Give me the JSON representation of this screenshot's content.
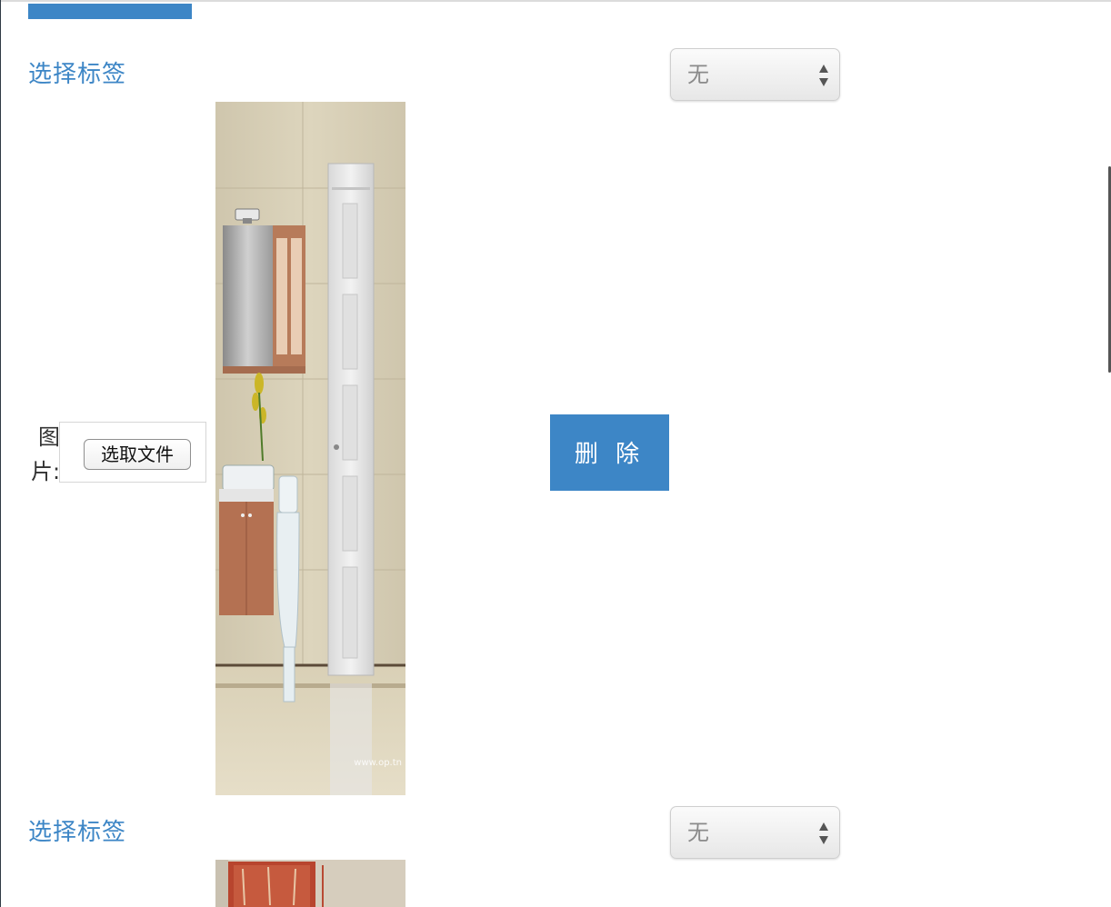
{
  "entries": [
    {
      "tag_label": "选择标签",
      "tag_select_value": "无",
      "image_label": "图片:",
      "file_button_label": "选取文件",
      "delete_button_label": "删 除"
    },
    {
      "tag_label": "选择标签",
      "tag_select_value": "无"
    }
  ],
  "photo_watermark": "www.op.tn",
  "icons": [
    "select-arrows-icon"
  ],
  "colors": {
    "accent": "#3d86c6",
    "select_text": "#8a8a8a",
    "label_text": "#333333"
  }
}
